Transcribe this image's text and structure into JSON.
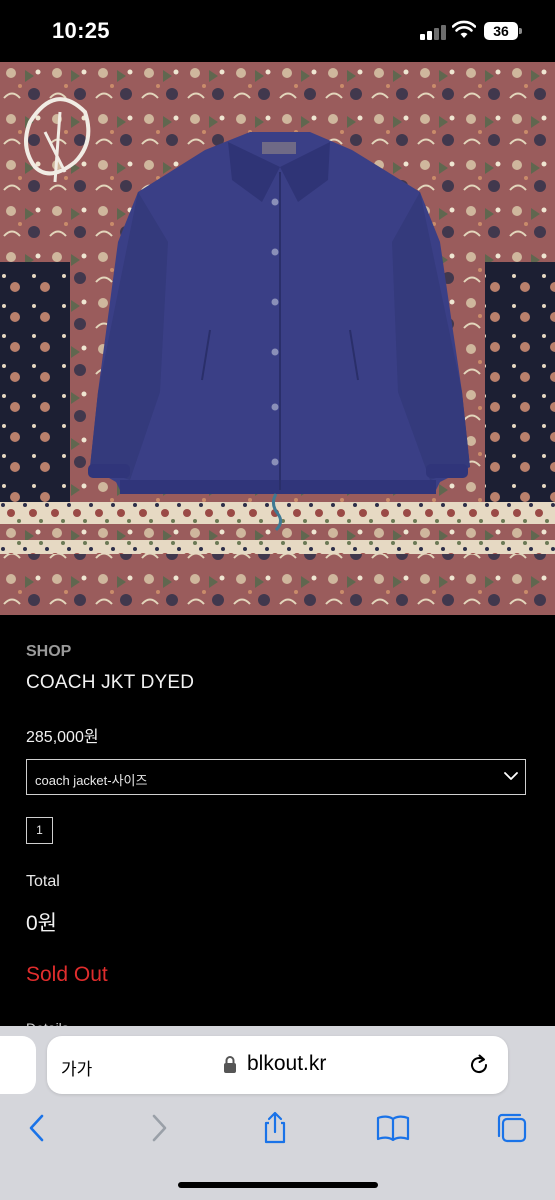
{
  "status_bar": {
    "time": "10:25",
    "battery": "36",
    "icons": [
      "cellular-signal-icon",
      "wifi-icon",
      "battery-icon"
    ]
  },
  "product": {
    "shop_label": "SHOP",
    "title": "COACH JKT DYED",
    "price": "285,000원",
    "option": {
      "selected": "coach jacket-사이즈",
      "icon": "chevron-down-icon"
    },
    "quantity": "1",
    "total_label": "Total",
    "total_value": "0원",
    "status": "Sold Out",
    "details_label": "Details",
    "colors": {
      "sold_out": "#e02d2d",
      "jacket": "#3a3f86",
      "rug": "#9a5c5c"
    }
  },
  "browser": {
    "text_size_label": "가가",
    "url": "blkout.kr",
    "icons": [
      "lock-icon",
      "reload-icon",
      "back-icon",
      "forward-icon",
      "share-icon",
      "bookmarks-icon",
      "tabs-icon"
    ],
    "accent": "#1a73e8"
  }
}
